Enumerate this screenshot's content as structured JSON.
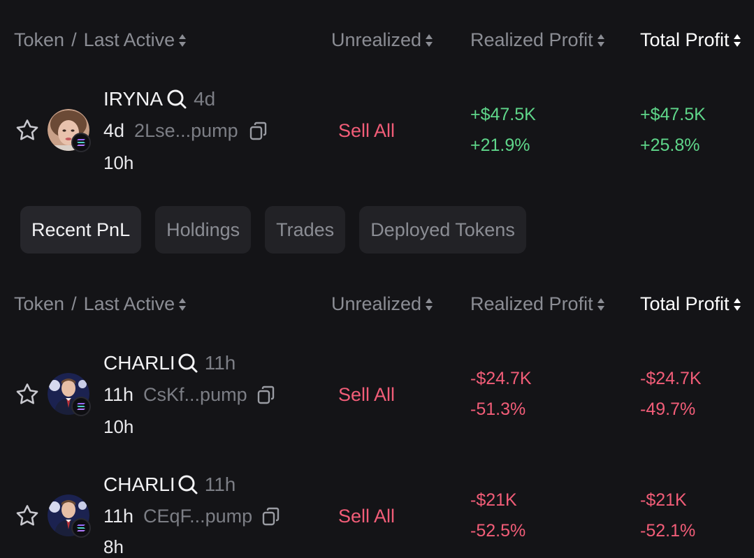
{
  "header": {
    "token": "Token",
    "slash": "/",
    "last_active": "Last Active",
    "unrealized": "Unrealized",
    "realized": "Realized Profit",
    "total": "Total Profit"
  },
  "top_row": {
    "name": "IRYNA",
    "name_ago": "4d",
    "age": "4d",
    "address": "2Lse...pump",
    "last": "10h",
    "sell": "Sell All",
    "realized_value": "+$47.5K",
    "realized_pct": "+21.9%",
    "total_value": "+$47.5K",
    "total_pct": "+25.8%"
  },
  "tabs": [
    "Recent PnL",
    "Holdings",
    "Trades",
    "Deployed Tokens"
  ],
  "rows": [
    {
      "name": "CHARLI",
      "name_ago": "11h",
      "age": "11h",
      "address": "CsKf...pump",
      "last": "10h",
      "sell": "Sell All",
      "realized_value": "-$24.7K",
      "realized_pct": "-51.3%",
      "total_value": "-$24.7K",
      "total_pct": "-49.7%"
    },
    {
      "name": "CHARLI",
      "name_ago": "11h",
      "age": "11h",
      "address": "CEqF...pump",
      "last": "8h",
      "sell": "Sell All",
      "realized_value": "-$21K",
      "realized_pct": "-52.5%",
      "total_value": "-$21K",
      "total_pct": "-52.1%"
    }
  ],
  "colors": {
    "positive": "#5fd68a",
    "negative": "#f25d78",
    "background": "#141417"
  }
}
